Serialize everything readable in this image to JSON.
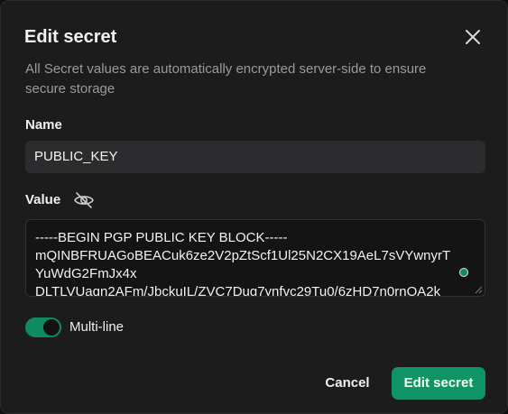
{
  "dialog": {
    "title": "Edit secret",
    "description": "All Secret values are automatically encrypted server-side to ensure secure storage"
  },
  "name_field": {
    "label": "Name",
    "value": "PUBLIC_KEY"
  },
  "value_field": {
    "label": "Value",
    "lines": [
      "-----BEGIN PGP PUBLIC KEY BLOCK-----",
      "mQINBFRUAGoBEACuk6ze2V2pZtScf1Ul25N2CX19AeL7sVYwnyrTYuWdG2FmJx4x",
      "DLTLVUaqn2AFm/JbckuIL/ZVC7Dug7ynfvc29Tu0/6zHD7n0rnOA2k"
    ]
  },
  "multiline_toggle": {
    "label": "Multi-line",
    "enabled": true
  },
  "actions": {
    "cancel_label": "Cancel",
    "submit_label": "Edit secret"
  },
  "colors": {
    "accent": "#119465",
    "background": "#1c1c1d",
    "field_background": "#2c2c2e"
  },
  "icons": {
    "close": "close-icon",
    "visibility": "eye-off-icon"
  }
}
